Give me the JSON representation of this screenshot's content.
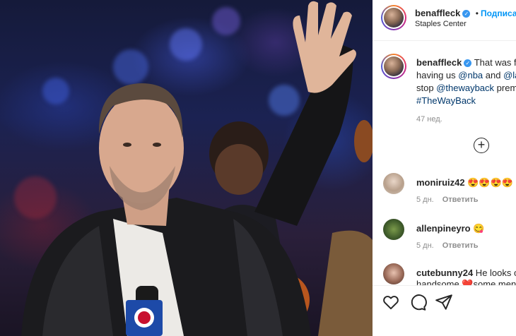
{
  "post": {
    "username": "benaffleck",
    "follow_label": "Подписаться",
    "location": "Staples Center",
    "caption_lines": [
      {
        "text": " That was fu",
        "mentions": []
      },
      {
        "prefix": "having us ",
        "mention1": "@nba",
        "middle": " and ",
        "mention2": "@la"
      },
      {
        "prefix": "stop ",
        "mention1": "@thewayback",
        "suffix": " prem"
      },
      {
        "hashtag": "#TheWayBack"
      }
    ],
    "time_ago": "47 нед."
  },
  "comments": [
    {
      "username": "moniruiz42",
      "text": " 😍😍😍😍",
      "time": "5 дн.",
      "reply": "Ответить"
    },
    {
      "username": "allenpineyro",
      "text": " 😋",
      "time": "5 дн.",
      "reply": "Ответить"
    },
    {
      "username": "cutebunny24",
      "text": " He looks o",
      "line2": "handsome ",
      "line2_tail": "some men",
      "heart": "❤️"
    }
  ],
  "icons": [
    "verified-badge-icon",
    "add-comment-plus-icon",
    "heart-icon",
    "comment-icon",
    "share-icon"
  ],
  "colors": {
    "link_blue": "#0095f6",
    "mention_blue": "#00376b",
    "muted": "#8e8e8e"
  }
}
